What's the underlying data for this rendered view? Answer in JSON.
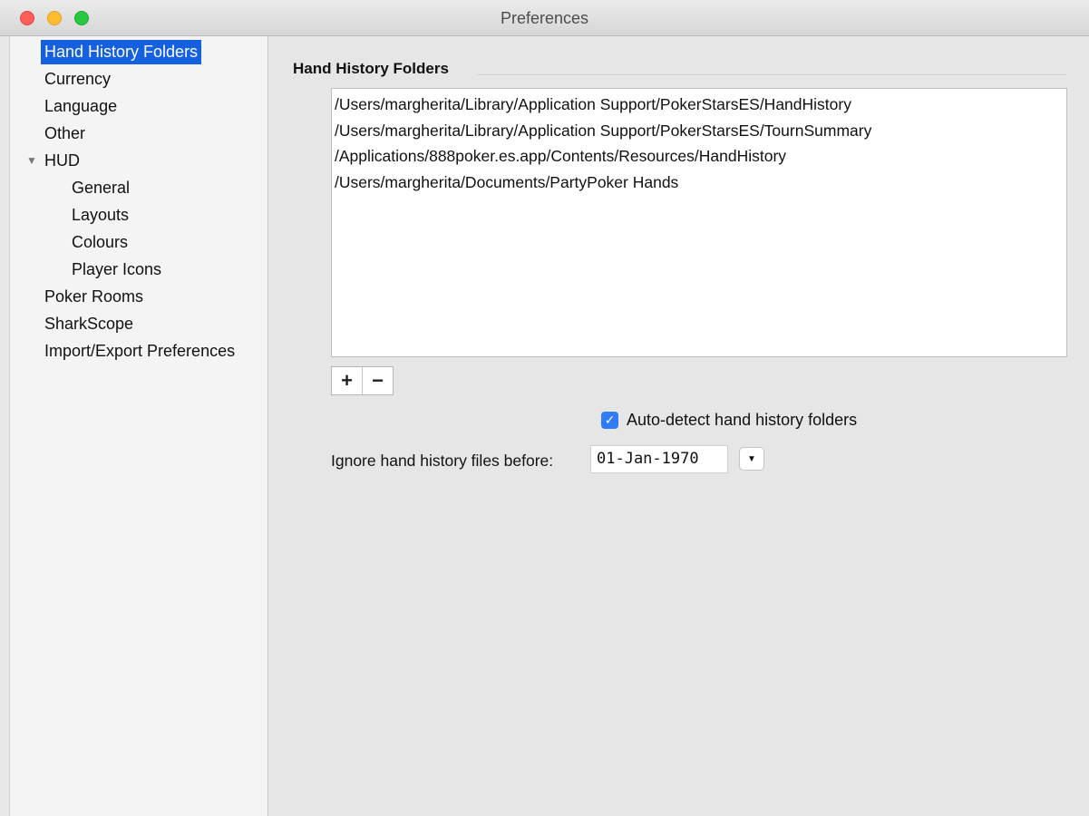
{
  "window": {
    "title": "Preferences"
  },
  "sidebar": {
    "items": [
      {
        "label": "Hand History Folders",
        "selected": true
      },
      {
        "label": "Currency"
      },
      {
        "label": "Language"
      },
      {
        "label": "Other"
      },
      {
        "label": "HUD",
        "expanded": true
      },
      {
        "label": "General"
      },
      {
        "label": "Layouts"
      },
      {
        "label": "Colours"
      },
      {
        "label": "Player Icons"
      },
      {
        "label": "Poker Rooms"
      },
      {
        "label": "SharkScope"
      },
      {
        "label": "Import/Export Preferences"
      }
    ],
    "expand_icon": "triangle-down-icon"
  },
  "main": {
    "section_title": "Hand History Folders",
    "folders": [
      "/Users/margherita/Library/Application Support/PokerStarsES/HandHistory",
      "/Users/margherita/Library/Application Support/PokerStarsES/TournSummary",
      "/Applications/888poker.es.app/Contents/Resources/HandHistory",
      "/Users/margherita/Documents/PartyPoker Hands"
    ],
    "add_button": "+",
    "remove_button": "−",
    "auto_detect": {
      "label": "Auto-detect hand history folders",
      "checked": true,
      "check_glyph": "✓"
    },
    "ignore_label": "Ignore hand history files before:",
    "ignore_date": "01-Jan-1970",
    "date_picker_glyph": "▼"
  },
  "colors": {
    "selection": "#1560e0",
    "checkbox": "#2f7cf6",
    "close": "#ff5f57",
    "minimize": "#ffbd2e",
    "maximize": "#28c940"
  }
}
